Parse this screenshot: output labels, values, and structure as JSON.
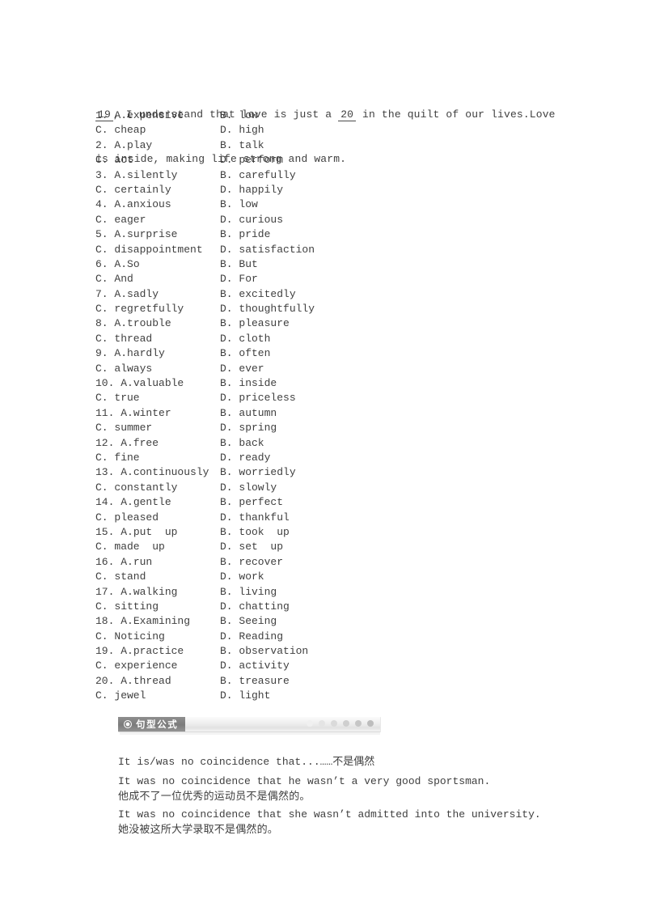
{
  "passage": {
    "line1_pre": "",
    "blank1": "19",
    "line1_mid": ", I understand that love is just a ",
    "blank2": "20",
    "line1_post": " in the quilt of our lives.Love",
    "line2": "is inside, making life strong and warm."
  },
  "options": [
    {
      "num": "1.",
      "a": "A.expensive",
      "b": "B. low",
      "c": "C. cheap",
      "d": "D. high"
    },
    {
      "num": "2.",
      "a": "A.play",
      "b": "B. talk",
      "c": "C. act",
      "d": "D. perform"
    },
    {
      "num": "3.",
      "a": "A.silently",
      "b": "B. carefully",
      "c": "C. certainly",
      "d": "D. happily"
    },
    {
      "num": "4.",
      "a": "A.anxious",
      "b": "B. low",
      "c": "C. eager",
      "d": "D. curious"
    },
    {
      "num": "5.",
      "a": "A.surprise",
      "b": "B. pride",
      "c": "C. disappointment",
      "d": "D. satisfaction"
    },
    {
      "num": "6.",
      "a": "A.So",
      "b": "B. But",
      "c": "C. And",
      "d": "D. For"
    },
    {
      "num": "7.",
      "a": "A.sadly",
      "b": "B. excitedly",
      "c": "C. regretfully",
      "d": "D. thoughtfully"
    },
    {
      "num": "8.",
      "a": "A.trouble",
      "b": "B. pleasure",
      "c": "C. thread",
      "d": "D. cloth"
    },
    {
      "num": "9.",
      "a": "A.hardly",
      "b": "B. often",
      "c": "C. always",
      "d": "D. ever"
    },
    {
      "num": "10.",
      "a": "A.valuable",
      "b": "B. inside",
      "c": "C. true",
      "d": "D. priceless"
    },
    {
      "num": "11.",
      "a": "A.winter",
      "b": "B. autumn",
      "c": "C. summer",
      "d": "D. spring"
    },
    {
      "num": "12.",
      "a": "A.free",
      "b": "B. back",
      "c": "C. fine",
      "d": "D. ready"
    },
    {
      "num": "13.",
      "a": "A.continuously",
      "b": "B. worriedly",
      "c": "C. constantly",
      "d": "D. slowly"
    },
    {
      "num": "14.",
      "a": "A.gentle",
      "b": "B. perfect",
      "c": "C. pleased",
      "d": "D. thankful"
    },
    {
      "num": "15.",
      "a": "A.put  up",
      "b": "B. took  up",
      "c": "C. made  up",
      "d": "D. set  up"
    },
    {
      "num": "16.",
      "a": "A.run",
      "b": "B. recover",
      "c": "C. stand",
      "d": "D. work"
    },
    {
      "num": "17.",
      "a": "A.walking",
      "b": "B. living",
      "c": "C. sitting",
      "d": "D. chatting"
    },
    {
      "num": "18.",
      "a": "A.Examining",
      "b": "B. Seeing",
      "c": "C. Noticing",
      "d": "D. Reading"
    },
    {
      "num": "19.",
      "a": "A.practice",
      "b": "B. observation",
      "c": "C. experience",
      "d": "D. activity"
    },
    {
      "num": "20.",
      "a": "A.thread",
      "b": "B. treasure",
      "c": "C. jewel",
      "d": "D. light"
    }
  ],
  "section": {
    "tab_label": "句型公式",
    "tab_icon": "filled-circle-icon",
    "dot_colors": [
      "#f0f0f0",
      "#e4e4e4",
      "#dadada",
      "#cfcfcf",
      "#c6c6c6",
      "#bdbdbd"
    ],
    "tab_bg": "#7c7c7c",
    "bar_bg": "#eeeeee"
  },
  "examples": {
    "headline": "It is/was no coincidence that...……不是偶然",
    "items": [
      {
        "en": "It was no coincidence that he wasn’t a very good sportsman.",
        "cn": "他成不了一位优秀的运动员不是偶然的。"
      },
      {
        "en": "It was no coincidence that she wasn’t admitted into the university.",
        "cn": "她没被这所大学录取不是偶然的。"
      }
    ]
  }
}
